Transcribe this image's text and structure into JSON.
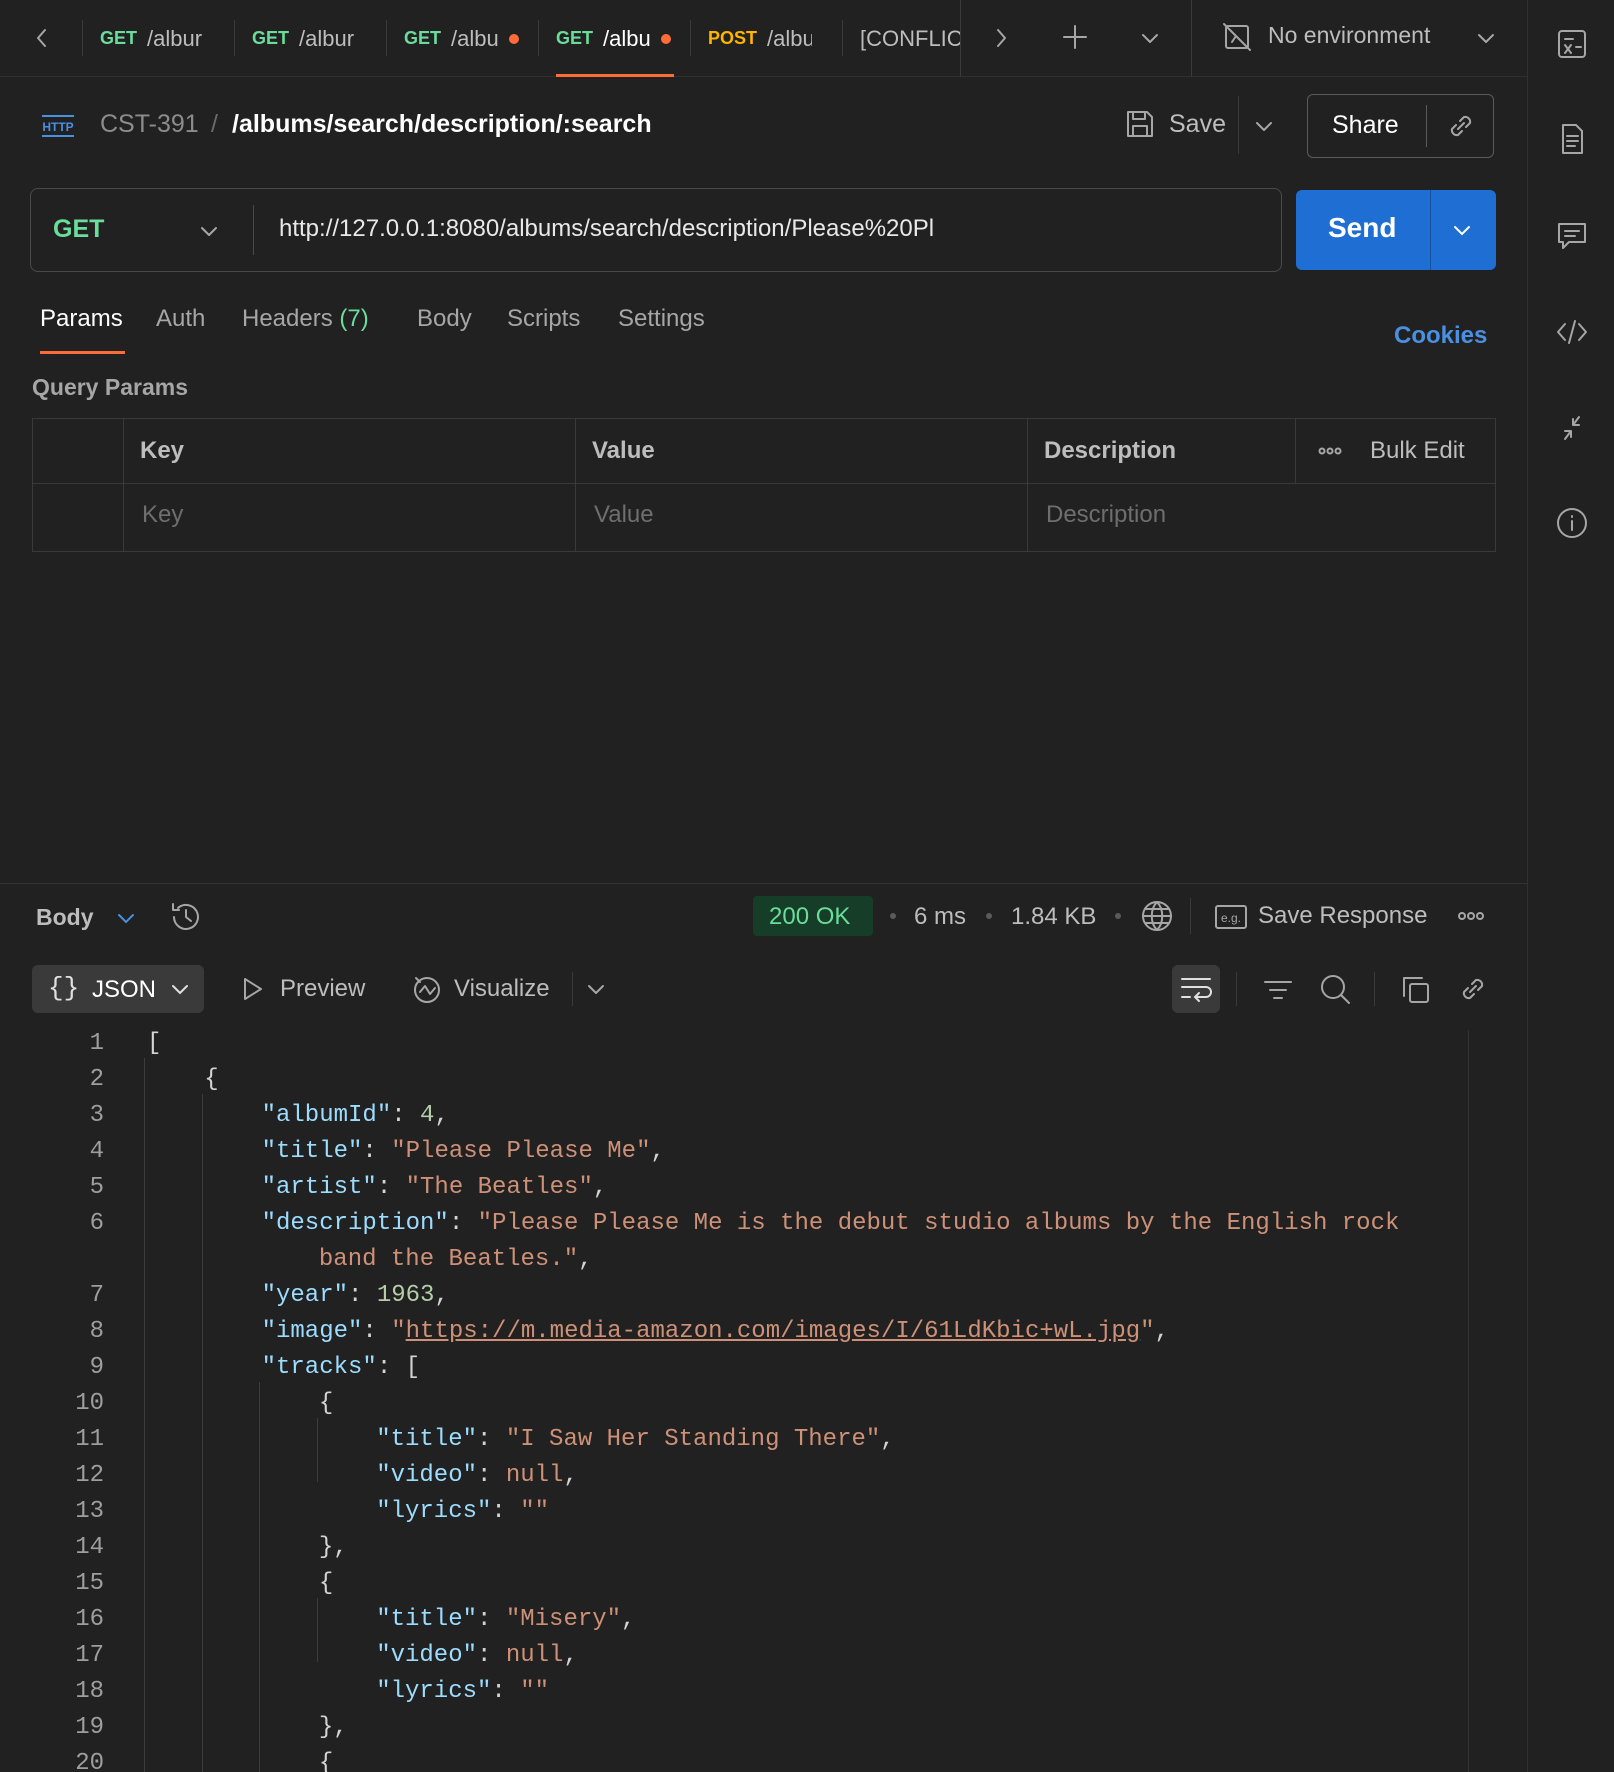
{
  "tabs": [
    {
      "method": "GET",
      "path": "/albur",
      "dirty": false,
      "active": false
    },
    {
      "method": "GET",
      "path": "/albur",
      "dirty": false,
      "active": false
    },
    {
      "method": "GET",
      "path": "/albu",
      "dirty": true,
      "active": false
    },
    {
      "method": "GET",
      "path": "/albu",
      "dirty": true,
      "active": true
    },
    {
      "method": "POST",
      "path": "/albu",
      "dirty": false,
      "active": false
    },
    {
      "method": "",
      "path": "[CONFLIC",
      "dirty": false,
      "active": false
    }
  ],
  "environment": {
    "label": "No environment"
  },
  "request": {
    "protocol_badge": "HTTP",
    "collection": "CST-391",
    "slash": "/",
    "name": "/albums/search/description/:search",
    "save_label": "Save",
    "share_label": "Share",
    "method": "GET",
    "url": "http://127.0.0.1:8080/albums/search/description/Please%20Pl",
    "send_label": "Send"
  },
  "request_tabs": {
    "params": "Params",
    "auth": "Auth",
    "headers": "Headers",
    "headers_count": "(7)",
    "body": "Body",
    "scripts": "Scripts",
    "settings": "Settings",
    "cookies": "Cookies"
  },
  "query_params": {
    "title": "Query Params",
    "headers": {
      "key": "Key",
      "value": "Value",
      "description": "Description",
      "bulk_edit": "Bulk Edit"
    },
    "placeholders": {
      "key": "Key",
      "value": "Value",
      "description": "Description"
    }
  },
  "response": {
    "body_label": "Body",
    "status": "200 OK",
    "time": "6 ms",
    "size": "1.84 KB",
    "save_response": "Save Response",
    "format": "JSON",
    "preview": "Preview",
    "visualize": "Visualize"
  },
  "code": {
    "line_numbers": [
      "1",
      "2",
      "3",
      "4",
      "5",
      "6",
      "",
      "7",
      "8",
      "9",
      "10",
      "11",
      "12",
      "13",
      "14",
      "15",
      "16",
      "17",
      "18",
      "19",
      "20"
    ],
    "lines": [
      {
        "indent": 0,
        "tokens": [
          [
            "pn",
            "["
          ]
        ]
      },
      {
        "indent": 1,
        "tokens": [
          [
            "pn",
            "{"
          ]
        ]
      },
      {
        "indent": 2,
        "tokens": [
          [
            "k",
            "\"albumId\""
          ],
          [
            "pn",
            ": "
          ],
          [
            "n",
            "4"
          ],
          [
            "pn",
            ","
          ]
        ]
      },
      {
        "indent": 2,
        "tokens": [
          [
            "k",
            "\"title\""
          ],
          [
            "pn",
            ": "
          ],
          [
            "s",
            "\"Please Please Me\""
          ],
          [
            "pn",
            ","
          ]
        ]
      },
      {
        "indent": 2,
        "tokens": [
          [
            "k",
            "\"artist\""
          ],
          [
            "pn",
            ": "
          ],
          [
            "s",
            "\"The Beatles\""
          ],
          [
            "pn",
            ","
          ]
        ]
      },
      {
        "indent": 2,
        "tokens": [
          [
            "k",
            "\"description\""
          ],
          [
            "pn",
            ": "
          ],
          [
            "s",
            "\"Please Please Me is the debut studio albums by the English rock"
          ]
        ]
      },
      {
        "indent": 3,
        "tokens": [
          [
            "s",
            "band the Beatles.\""
          ],
          [
            "pn",
            ","
          ]
        ]
      },
      {
        "indent": 2,
        "tokens": [
          [
            "k",
            "\"year\""
          ],
          [
            "pn",
            ": "
          ],
          [
            "n",
            "1963"
          ],
          [
            "pn",
            ","
          ]
        ]
      },
      {
        "indent": 2,
        "tokens": [
          [
            "k",
            "\"image\""
          ],
          [
            "pn",
            ": "
          ],
          [
            "s",
            "\""
          ],
          [
            "su",
            "https://m.media-amazon.com/images/I/61LdKbic+wL.jpg"
          ],
          [
            "s",
            "\""
          ],
          [
            "pn",
            ","
          ]
        ]
      },
      {
        "indent": 2,
        "tokens": [
          [
            "k",
            "\"tracks\""
          ],
          [
            "pn",
            ": ["
          ]
        ]
      },
      {
        "indent": 3,
        "tokens": [
          [
            "pn",
            "{"
          ]
        ]
      },
      {
        "indent": 4,
        "tokens": [
          [
            "k",
            "\"title\""
          ],
          [
            "pn",
            ": "
          ],
          [
            "s",
            "\"I Saw Her Standing There\""
          ],
          [
            "pn",
            ","
          ]
        ]
      },
      {
        "indent": 4,
        "tokens": [
          [
            "k",
            "\"video\""
          ],
          [
            "pn",
            ": "
          ],
          [
            "s",
            "null"
          ],
          [
            "pn",
            ","
          ]
        ]
      },
      {
        "indent": 4,
        "tokens": [
          [
            "k",
            "\"lyrics\""
          ],
          [
            "pn",
            ": "
          ],
          [
            "s",
            "\"\""
          ]
        ]
      },
      {
        "indent": 3,
        "tokens": [
          [
            "pn",
            "},"
          ]
        ]
      },
      {
        "indent": 3,
        "tokens": [
          [
            "pn",
            "{"
          ]
        ]
      },
      {
        "indent": 4,
        "tokens": [
          [
            "k",
            "\"title\""
          ],
          [
            "pn",
            ": "
          ],
          [
            "s",
            "\"Misery\""
          ],
          [
            "pn",
            ","
          ]
        ]
      },
      {
        "indent": 4,
        "tokens": [
          [
            "k",
            "\"video\""
          ],
          [
            "pn",
            ": "
          ],
          [
            "s",
            "null"
          ],
          [
            "pn",
            ","
          ]
        ]
      },
      {
        "indent": 4,
        "tokens": [
          [
            "k",
            "\"lyrics\""
          ],
          [
            "pn",
            ": "
          ],
          [
            "s",
            "\"\""
          ]
        ]
      },
      {
        "indent": 3,
        "tokens": [
          [
            "pn",
            "},"
          ]
        ]
      },
      {
        "indent": 3,
        "tokens": [
          [
            "pn",
            "{"
          ]
        ]
      }
    ]
  },
  "colors": {
    "accent": "#ff6c37",
    "send": "#1f6ed4",
    "get": "#6bdd9a",
    "post": "#ffb400",
    "link": "#4a90e2",
    "status_ok": "#6bdd9a"
  }
}
